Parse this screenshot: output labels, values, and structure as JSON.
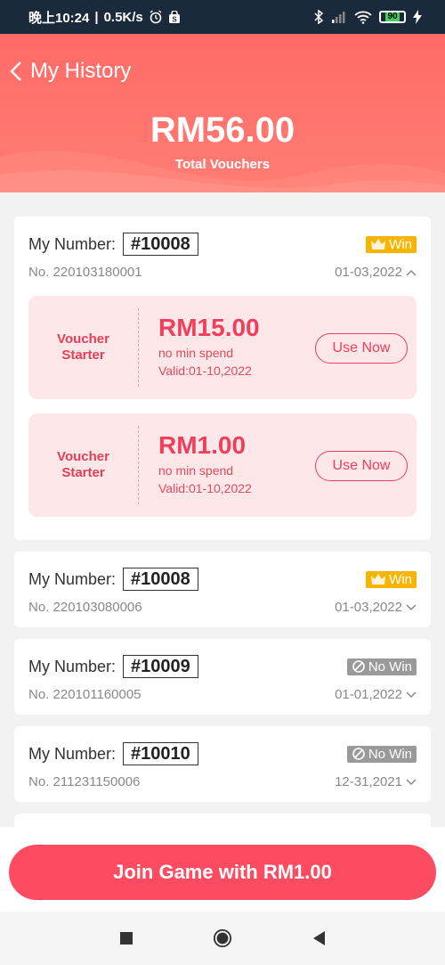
{
  "status_bar": {
    "time": "晚上10:24",
    "net_speed": "0.5K/s",
    "battery": "90"
  },
  "header": {
    "title": "My History",
    "total_amount": "RM56.00",
    "total_label": "Total Vouchers"
  },
  "labels": {
    "my_number": "My Number:"
  },
  "records": [
    {
      "number": "#10008",
      "result": "Win",
      "no": "No. 220103180001",
      "date": "01-03,2022",
      "expanded": true,
      "vouchers": [
        {
          "type": "Voucher Starter",
          "amount": "RM15.00",
          "condition": "no min spend",
          "valid": "Valid:01-10,2022",
          "button": "Use Now"
        },
        {
          "type": "Voucher Starter",
          "amount": "RM1.00",
          "condition": "no min spend",
          "valid": "Valid:01-10,2022",
          "button": "Use Now"
        }
      ]
    },
    {
      "number": "#10008",
      "result": "Win",
      "no": "No. 220103080006",
      "date": "01-03,2022",
      "expanded": false
    },
    {
      "number": "#10009",
      "result": "No Win",
      "no": "No. 220101160005",
      "date": "01-01,2022",
      "expanded": false
    },
    {
      "number": "#10010",
      "result": "No Win",
      "no": "No. 211231150006",
      "date": "12-31,2021",
      "expanded": false
    }
  ],
  "footer": {
    "join_button": "Join Game with RM1.00"
  },
  "colors": {
    "header": "#ff6b67",
    "accent": "#fd4c61",
    "win_badge": "#f7b500",
    "nowin_badge": "#9a9a9a"
  }
}
